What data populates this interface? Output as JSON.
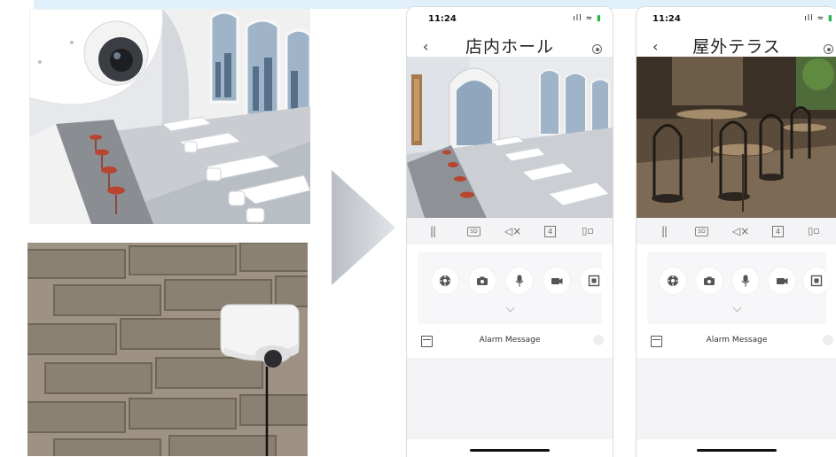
{
  "phones": [
    {
      "status_time": "11:24",
      "title": "店内ホール",
      "feed_scene": "cafe-interior",
      "alarm_label": "Alarm Message",
      "controls": {
        "sd_label": "SD",
        "split_label": "4"
      }
    },
    {
      "status_time": "11:24",
      "title": "屋外テラス",
      "feed_scene": "outdoor-terrace",
      "alarm_label": "Alarm Message",
      "controls": {
        "sd_label": "SD",
        "split_label": "4"
      }
    }
  ],
  "colors": {
    "accent_band": "#dff0fa",
    "arrow": "#c8cdd2",
    "panel_bg": "#f7f7f9",
    "battery": "#2bb34a"
  },
  "icons": {
    "controls": [
      "pause-icon",
      "sd-quality-icon",
      "speaker-mute-icon",
      "split-screen-icon",
      "rotate-icon"
    ],
    "actions": [
      "ptz-icon",
      "snapshot-icon",
      "microphone-icon",
      "record-icon",
      "fullscreen-icon"
    ]
  }
}
